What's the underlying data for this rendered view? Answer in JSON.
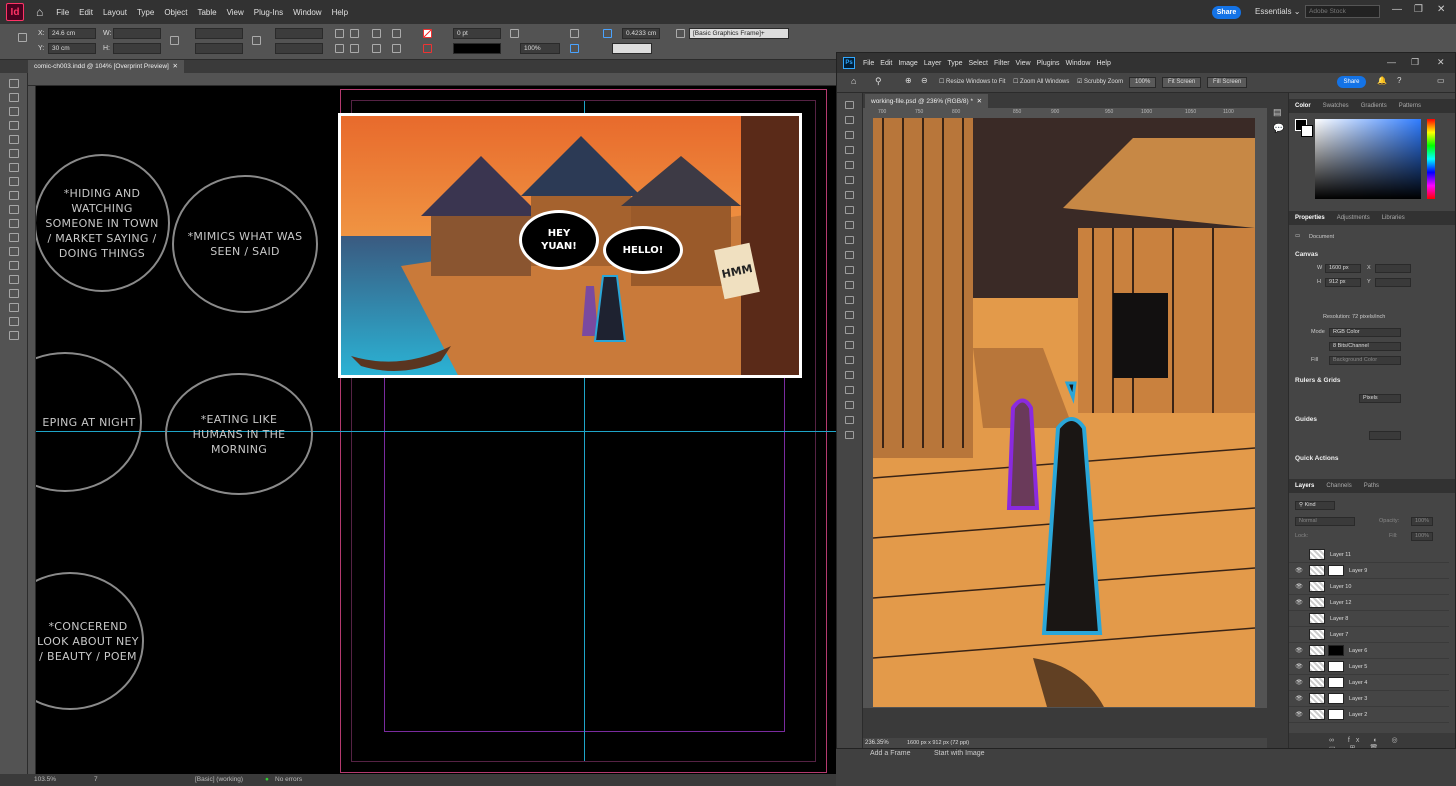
{
  "indesign": {
    "logo": "Id",
    "menu": [
      "File",
      "Edit",
      "Layout",
      "Type",
      "Object",
      "Table",
      "View",
      "Plug-Ins",
      "Window",
      "Help"
    ],
    "share_label": "Share",
    "workspace": "Essentials",
    "stock_search_placeholder": "Adobe Stock",
    "control": {
      "x_label": "X:",
      "x_value": "24.6 cm",
      "y_label": "Y:",
      "y_value": "30 cm",
      "w_label": "W:",
      "h_label": "H:",
      "stroke_value": "0 pt",
      "scale_value": "100%",
      "offset_value": "0.4233 cm",
      "frame_style": "[Basic Graphics Frame]+"
    },
    "doc_tab": "comic-ch003.indd @ 104% [Overprint Preview]",
    "circles": [
      {
        "text": "*HIDING AND WATCHING SOMEONE IN TOWN / MARKET SAYING / DOING THINGS"
      },
      {
        "text": "*MIMICS WHAT WAS SEEN / SAID"
      },
      {
        "text": "EPING AT NIGHT"
      },
      {
        "text": "*EATING LIKE HUMANS IN THE MORNING"
      },
      {
        "text": "*CONCEREND LOOK ABOUT NEY / BEAUTY / POEM"
      }
    ],
    "bubbles": [
      "HEY YUAN!",
      "HELLO!"
    ],
    "sfx": "HMM",
    "status": {
      "zoom": "103.5%",
      "page": "7",
      "style": "[Basic] (working)",
      "errors": "No errors"
    },
    "colors": {
      "accent": "#1473e6",
      "logo": "#ff3366",
      "guide_cyan": "#1ea5c8",
      "guide_purple": "#7a2b9e"
    }
  },
  "photoshop": {
    "logo": "Ps",
    "menu": [
      "File",
      "Edit",
      "Image",
      "Layer",
      "Type",
      "Select",
      "Filter",
      "View",
      "Plugins",
      "Window",
      "Help"
    ],
    "options": {
      "resize_windows": "Resize Windows to Fit",
      "zoom_all": "Zoom All Windows",
      "scrubby_zoom": "Scrubby Zoom",
      "zoom_value": "100%",
      "fit_screen": "Fit Screen",
      "fill_screen": "Fill Screen",
      "share": "Share"
    },
    "doc_tab": "working-file.psd @ 236% (RGB/8) *",
    "ruler_marks": [
      "700",
      "750",
      "800",
      "850",
      "900",
      "950",
      "1000",
      "1050",
      "1100"
    ],
    "status_zoom": "236.35%",
    "status_info": "1600 px x 912 px (72 ppi)",
    "color_tabs": [
      "Color",
      "Swatches",
      "Gradients",
      "Patterns"
    ],
    "prop_tabs": [
      "Properties",
      "Adjustments",
      "Libraries"
    ],
    "properties": {
      "document": "Document",
      "canvas": "Canvas",
      "w_label": "W",
      "w_value": "1600 px",
      "x_label": "X",
      "h_label": "H",
      "h_value": "912 px",
      "y_label": "Y",
      "resolution": "Resolution: 72 pixels/inch",
      "mode_label": "Mode",
      "mode_value": "RGB Color",
      "bits_value": "8 Bits/Channel",
      "fill_label": "Fill",
      "fill_value": "Background Color",
      "rulers_grids": "Rulers & Grids",
      "units": "Pixels",
      "guides": "Guides",
      "quick_actions": "Quick Actions"
    },
    "layer_tabs": [
      "Layers",
      "Channels",
      "Paths"
    ],
    "layer_filter": "Kind",
    "blend_mode": "Normal",
    "opacity_label": "Opacity:",
    "opacity_value": "100%",
    "lock_label": "Lock:",
    "fill_label2": "Fill:",
    "fill_pct": "100%",
    "layers": [
      {
        "name": "Layer 11",
        "visible": false
      },
      {
        "name": "Layer 9",
        "visible": true
      },
      {
        "name": "Layer 10",
        "visible": true
      },
      {
        "name": "Layer 12",
        "visible": true
      },
      {
        "name": "Layer 8",
        "visible": false
      },
      {
        "name": "Layer 7",
        "visible": false
      },
      {
        "name": "Layer 6",
        "visible": true
      },
      {
        "name": "Layer 5",
        "visible": true
      },
      {
        "name": "Layer 4",
        "visible": true
      },
      {
        "name": "Layer 3",
        "visible": true
      },
      {
        "name": "Layer 2",
        "visible": true
      }
    ],
    "taskbar": [
      "Add a Frame",
      "Start with Image"
    ]
  }
}
